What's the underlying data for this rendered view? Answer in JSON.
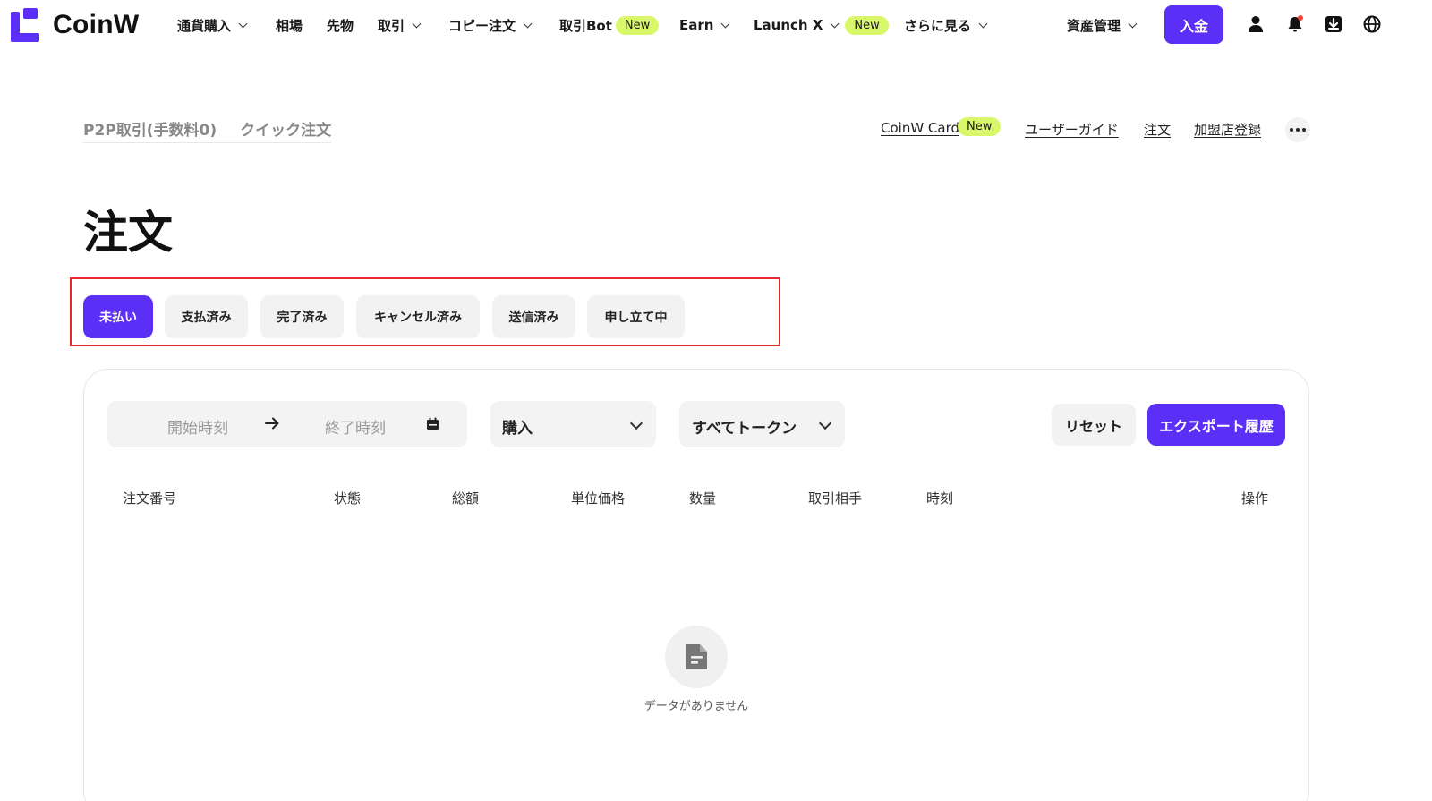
{
  "brand": {
    "name": "CoinW",
    "accent": "#5b2ff5",
    "badge_color": "#d9f76a"
  },
  "nav": {
    "items": [
      {
        "label": "通貨購入",
        "dropdown": true
      },
      {
        "label": "相場",
        "dropdown": false
      },
      {
        "label": "先物",
        "dropdown": false
      },
      {
        "label": "取引",
        "dropdown": true
      },
      {
        "label": "コピー注文",
        "dropdown": true
      },
      {
        "label": "取引Bot",
        "badge": "New"
      },
      {
        "label": "Earn",
        "dropdown": true
      },
      {
        "label": "Launch X",
        "dropdown": true,
        "badge": "New"
      },
      {
        "label": "さらに見る",
        "dropdown": true
      }
    ],
    "assets_label": "資産管理",
    "deposit_label": "入金",
    "icons": [
      "user-icon",
      "bell-icon",
      "download-icon",
      "globe-icon"
    ]
  },
  "subnav": {
    "tabs": [
      "P2P取引(手数料0)",
      "クイック注文"
    ],
    "links": [
      {
        "label": "CoinW Card",
        "badge": "New"
      },
      {
        "label": "ユーザーガイド"
      },
      {
        "label": "注文"
      },
      {
        "label": "加盟店登録"
      }
    ]
  },
  "page": {
    "title": "注文"
  },
  "status_tabs": {
    "items": [
      "未払い",
      "支払済み",
      "完了済み",
      "キャンセル済み",
      "送信済み",
      "申し立て中"
    ],
    "active_index": 0
  },
  "filters": {
    "start_placeholder": "開始時刻",
    "end_placeholder": "終了時刻",
    "side": "購入",
    "token": "すべてトークン",
    "reset_label": "リセット",
    "export_label": "エクスポート履歴"
  },
  "table": {
    "columns": [
      "注文番号",
      "状態",
      "総額",
      "単位価格",
      "数量",
      "取引相手",
      "時刻",
      "操作"
    ],
    "rows": []
  },
  "empty_state": {
    "text": "データがありません"
  }
}
